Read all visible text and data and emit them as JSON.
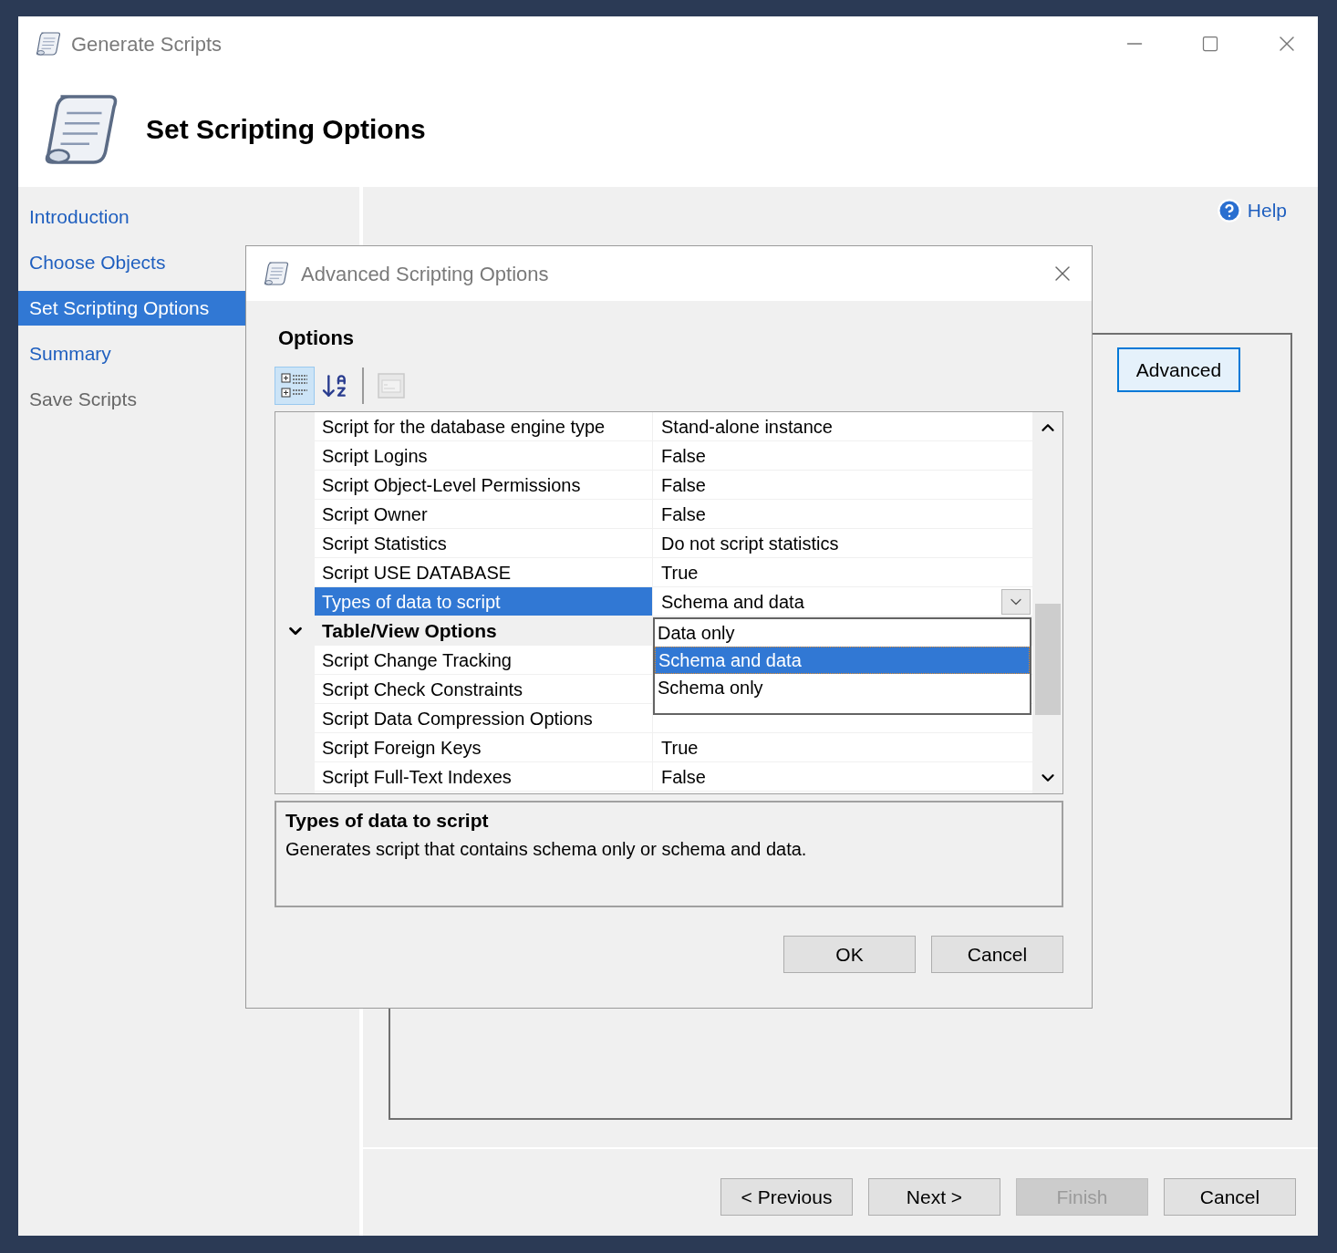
{
  "window": {
    "title": "Generate Scripts"
  },
  "header": {
    "title": "Set Scripting Options"
  },
  "sidebar": {
    "items": [
      {
        "label": "Introduction",
        "selected": false,
        "disabled": false
      },
      {
        "label": "Choose Objects",
        "selected": false,
        "disabled": false
      },
      {
        "label": "Set Scripting Options",
        "selected": true,
        "disabled": false
      },
      {
        "label": "Summary",
        "selected": false,
        "disabled": false
      },
      {
        "label": "Save Scripts",
        "selected": false,
        "disabled": true
      }
    ]
  },
  "help_link": "Help",
  "advanced_button": "Advanced",
  "nav_buttons": [
    {
      "label": "< Previous",
      "disabled": false
    },
    {
      "label": "Next >",
      "disabled": false
    },
    {
      "label": "Finish",
      "disabled": true
    },
    {
      "label": "Cancel",
      "disabled": false
    }
  ],
  "dialog": {
    "title": "Advanced Scripting Options",
    "section_label": "Options",
    "toolbar": [
      {
        "kind": "categorized",
        "selected": true,
        "disabled": false
      },
      {
        "kind": "alphabetical",
        "selected": false,
        "disabled": false
      },
      {
        "kind": "property_pages",
        "selected": false,
        "disabled": true
      }
    ],
    "grid": {
      "rows": [
        {
          "kind": "property",
          "name": "Script for the database engine type",
          "value": "Stand-alone instance",
          "selected": false
        },
        {
          "kind": "property",
          "name": "Script Logins",
          "value": "False",
          "selected": false
        },
        {
          "kind": "property",
          "name": "Script Object-Level Permissions",
          "value": "False",
          "selected": false
        },
        {
          "kind": "property",
          "name": "Script Owner",
          "value": "False",
          "selected": false
        },
        {
          "kind": "property",
          "name": "Script Statistics",
          "value": "Do not script statistics",
          "selected": false
        },
        {
          "kind": "property",
          "name": "Script USE DATABASE",
          "value": "True",
          "selected": false
        },
        {
          "kind": "property",
          "name": "Types of data to script",
          "value": "Schema and data",
          "selected": true
        },
        {
          "kind": "category",
          "name": "Table/View Options",
          "expanded": true
        },
        {
          "kind": "property",
          "name": "Script Change Tracking",
          "selected": false
        },
        {
          "kind": "property",
          "name": "Script Check Constraints",
          "selected": false
        },
        {
          "kind": "property",
          "name": "Script Data Compression Options",
          "selected": false
        },
        {
          "kind": "property",
          "name": "Script Foreign Keys",
          "value": "True",
          "selected": false
        },
        {
          "kind": "property",
          "name": "Script Full-Text Indexes",
          "value": "False",
          "selected": false
        }
      ],
      "dropdown": {
        "options": [
          {
            "label": "Data only",
            "selected": false
          },
          {
            "label": "Schema and data",
            "selected": true
          },
          {
            "label": "Schema only",
            "selected": false
          }
        ]
      }
    },
    "description": {
      "title": "Types of data to script",
      "text": "Generates script that contains schema only or schema and data."
    },
    "buttons": [
      "OK",
      "Cancel"
    ]
  }
}
